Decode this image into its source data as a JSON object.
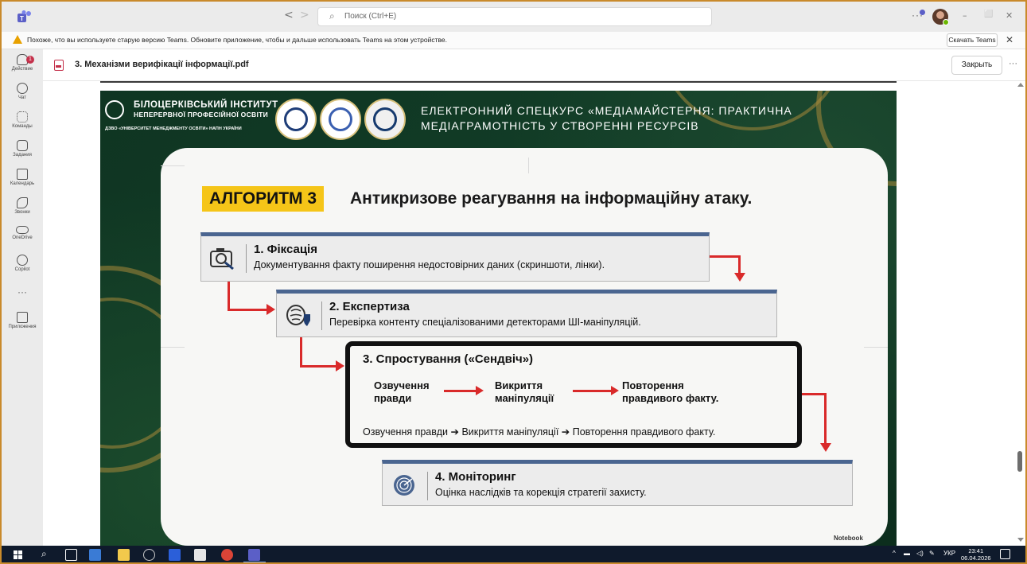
{
  "window": {
    "search_placeholder": "Поиск (Ctrl+E)",
    "nav_back": "<",
    "nav_forward": ">",
    "more": "···",
    "minimize": "–",
    "maximize": "⬜",
    "close": "✕"
  },
  "notification": {
    "text": "Похоже, что вы используете старую версию Teams. Обновите приложение, чтобы и дальше использовать Teams на этом устройстве.",
    "button": "Скачать Teams",
    "close": "✕"
  },
  "rail": {
    "items": [
      {
        "label": "Действие",
        "icon": "bell-icon",
        "badge": "1"
      },
      {
        "label": "Чат",
        "icon": "chat-icon"
      },
      {
        "label": "Команды",
        "icon": "teams-icon"
      },
      {
        "label": "Задания",
        "icon": "assignments-icon"
      },
      {
        "label": "Календарь",
        "icon": "calendar-icon"
      },
      {
        "label": "Звонки",
        "icon": "phone-icon"
      },
      {
        "label": "OneDrive",
        "icon": "cloud-icon"
      },
      {
        "label": "Copilot",
        "icon": "copilot-icon"
      },
      {
        "label": "Приложения",
        "icon": "add-app-icon"
      }
    ],
    "more": "···"
  },
  "file": {
    "name": "3. Механізми верифікації інформації.pdf",
    "close_button": "Закрыть",
    "more": "···"
  },
  "slide": {
    "institute_line1": "БІЛОЦЕРКІВСЬКИЙ ІНСТИТУТ",
    "institute_line2": "НЕПЕРЕРВНОЇ ПРОФЕСІЙНОЇ ОСВІТИ",
    "institute_line3": "ДЗВО «УНІВЕРСИТЕТ МЕНЕДЖМЕНТУ ОСВІТИ» НАПН УКРАЇНИ",
    "course_title": "ЕЛЕКТРОННИЙ СПЕЦКУРС «МЕДІАМАЙСТЕРНЯ: ПРАКТИЧНА МЕДІАГРАМОТНІСТЬ У СТВОРЕННІ РЕСУРСІВ",
    "algo_tag": "АЛГОРИТМ 3",
    "algo_title": "Антикризове реагування на інформаційну атаку.",
    "steps": [
      {
        "title": "1. Фіксація",
        "desc": "Документування факту поширення недостовірних даних (скриншоти, лінки).",
        "icon": "camera-search-icon"
      },
      {
        "title": "2. Експертиза",
        "desc": "Перевірка контенту спеціалізованими детекторами ШІ-маніпуляцій.",
        "icon": "brain-shield-icon"
      },
      {
        "title": "4. Моніторинг",
        "desc": "Оцінка наслідків та корекція стратегії захисту.",
        "icon": "radar-icon"
      }
    ],
    "sandwich": {
      "title": "3. Спростування («Сендвіч»)",
      "item1": "Озвучення\nправди",
      "item2": "Викриття\nманіпуляції",
      "item3": "Повторення\nправдивого факту.",
      "line": "Озвучення правди ➔ Викриття маніпуляції ➔ Повторення правдивого факту."
    },
    "watermark": "Notebook"
  },
  "taskbar": {
    "lang": "УКР",
    "time": "23:41",
    "date": "06.04.2026",
    "chevron": "^"
  },
  "colors": {
    "accent_red": "#d92a2a",
    "tag_yellow": "#f5c518",
    "step_bar_blue": "#4a6590",
    "slide_green": "#123d27"
  }
}
